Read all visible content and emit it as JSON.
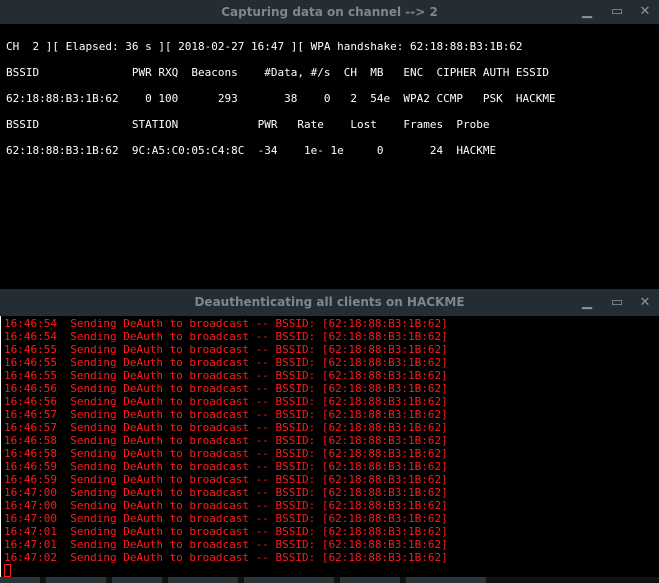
{
  "top_window": {
    "title": "Capturing data on channel --> 2",
    "lines": [
      "CH  2 ][ Elapsed: 36 s ][ 2018-02-27 16:47 ][ WPA handshake: 62:18:88:B3:1B:62",
      "BSSID              PWR RXQ  Beacons    #Data, #/s  CH  MB   ENC  CIPHER AUTH ESSID",
      "62:18:88:B3:1B:62    0 100      293       38    0   2  54e  WPA2 CCMP   PSK  HACKME",
      "BSSID              STATION            PWR   Rate    Lost    Frames  Probe",
      "62:18:88:B3:1B:62  9C:A5:C0:05:C4:8C  -34    1e- 1e     0       24  HACKME"
    ]
  },
  "bottom_window": {
    "title": "Deauthenticating all clients on HACKME",
    "lines": [
      "16:46:54  Sending DeAuth to broadcast -- BSSID: [62:18:88:B3:1B:62]",
      "16:46:54  Sending DeAuth to broadcast -- BSSID: [62:18:88:B3:1B:62]",
      "16:46:55  Sending DeAuth to broadcast -- BSSID: [62:18:88:B3:1B:62]",
      "16:46:55  Sending DeAuth to broadcast -- BSSID: [62:18:88:B3:1B:62]",
      "16:46:55  Sending DeAuth to broadcast -- BSSID: [62:18:88:B3:1B:62]",
      "16:46:56  Sending DeAuth to broadcast -- BSSID: [62:18:88:B3:1B:62]",
      "16:46:56  Sending DeAuth to broadcast -- BSSID: [62:18:88:B3:1B:62]",
      "16:46:57  Sending DeAuth to broadcast -- BSSID: [62:18:88:B3:1B:62]",
      "16:46:57  Sending DeAuth to broadcast -- BSSID: [62:18:88:B3:1B:62]",
      "16:46:58  Sending DeAuth to broadcast -- BSSID: [62:18:88:B3:1B:62]",
      "16:46:58  Sending DeAuth to broadcast -- BSSID: [62:18:88:B3:1B:62]",
      "16:46:59  Sending DeAuth to broadcast -- BSSID: [62:18:88:B3:1B:62]",
      "16:46:59  Sending DeAuth to broadcast -- BSSID: [62:18:88:B3:1B:62]",
      "16:47:00  Sending DeAuth to broadcast -- BSSID: [62:18:88:B3:1B:62]",
      "16:47:00  Sending DeAuth to broadcast -- BSSID: [62:18:88:B3:1B:62]",
      "16:47:00  Sending DeAuth to broadcast -- BSSID: [62:18:88:B3:1B:62]",
      "16:47:01  Sending DeAuth to broadcast -- BSSID: [62:18:88:B3:1B:62]",
      "16:47:01  Sending DeAuth to broadcast -- BSSID: [62:18:88:B3:1B:62]",
      "16:47:02  Sending DeAuth to broadcast -- BSSID: [62:18:88:B3:1B:62]"
    ]
  },
  "icons": {
    "minimize": "minimize-icon",
    "maximize": "maximize-icon",
    "close": "close-icon"
  },
  "colors": {
    "titlebar": "#232d33",
    "log_text": "#ff1a1a"
  }
}
